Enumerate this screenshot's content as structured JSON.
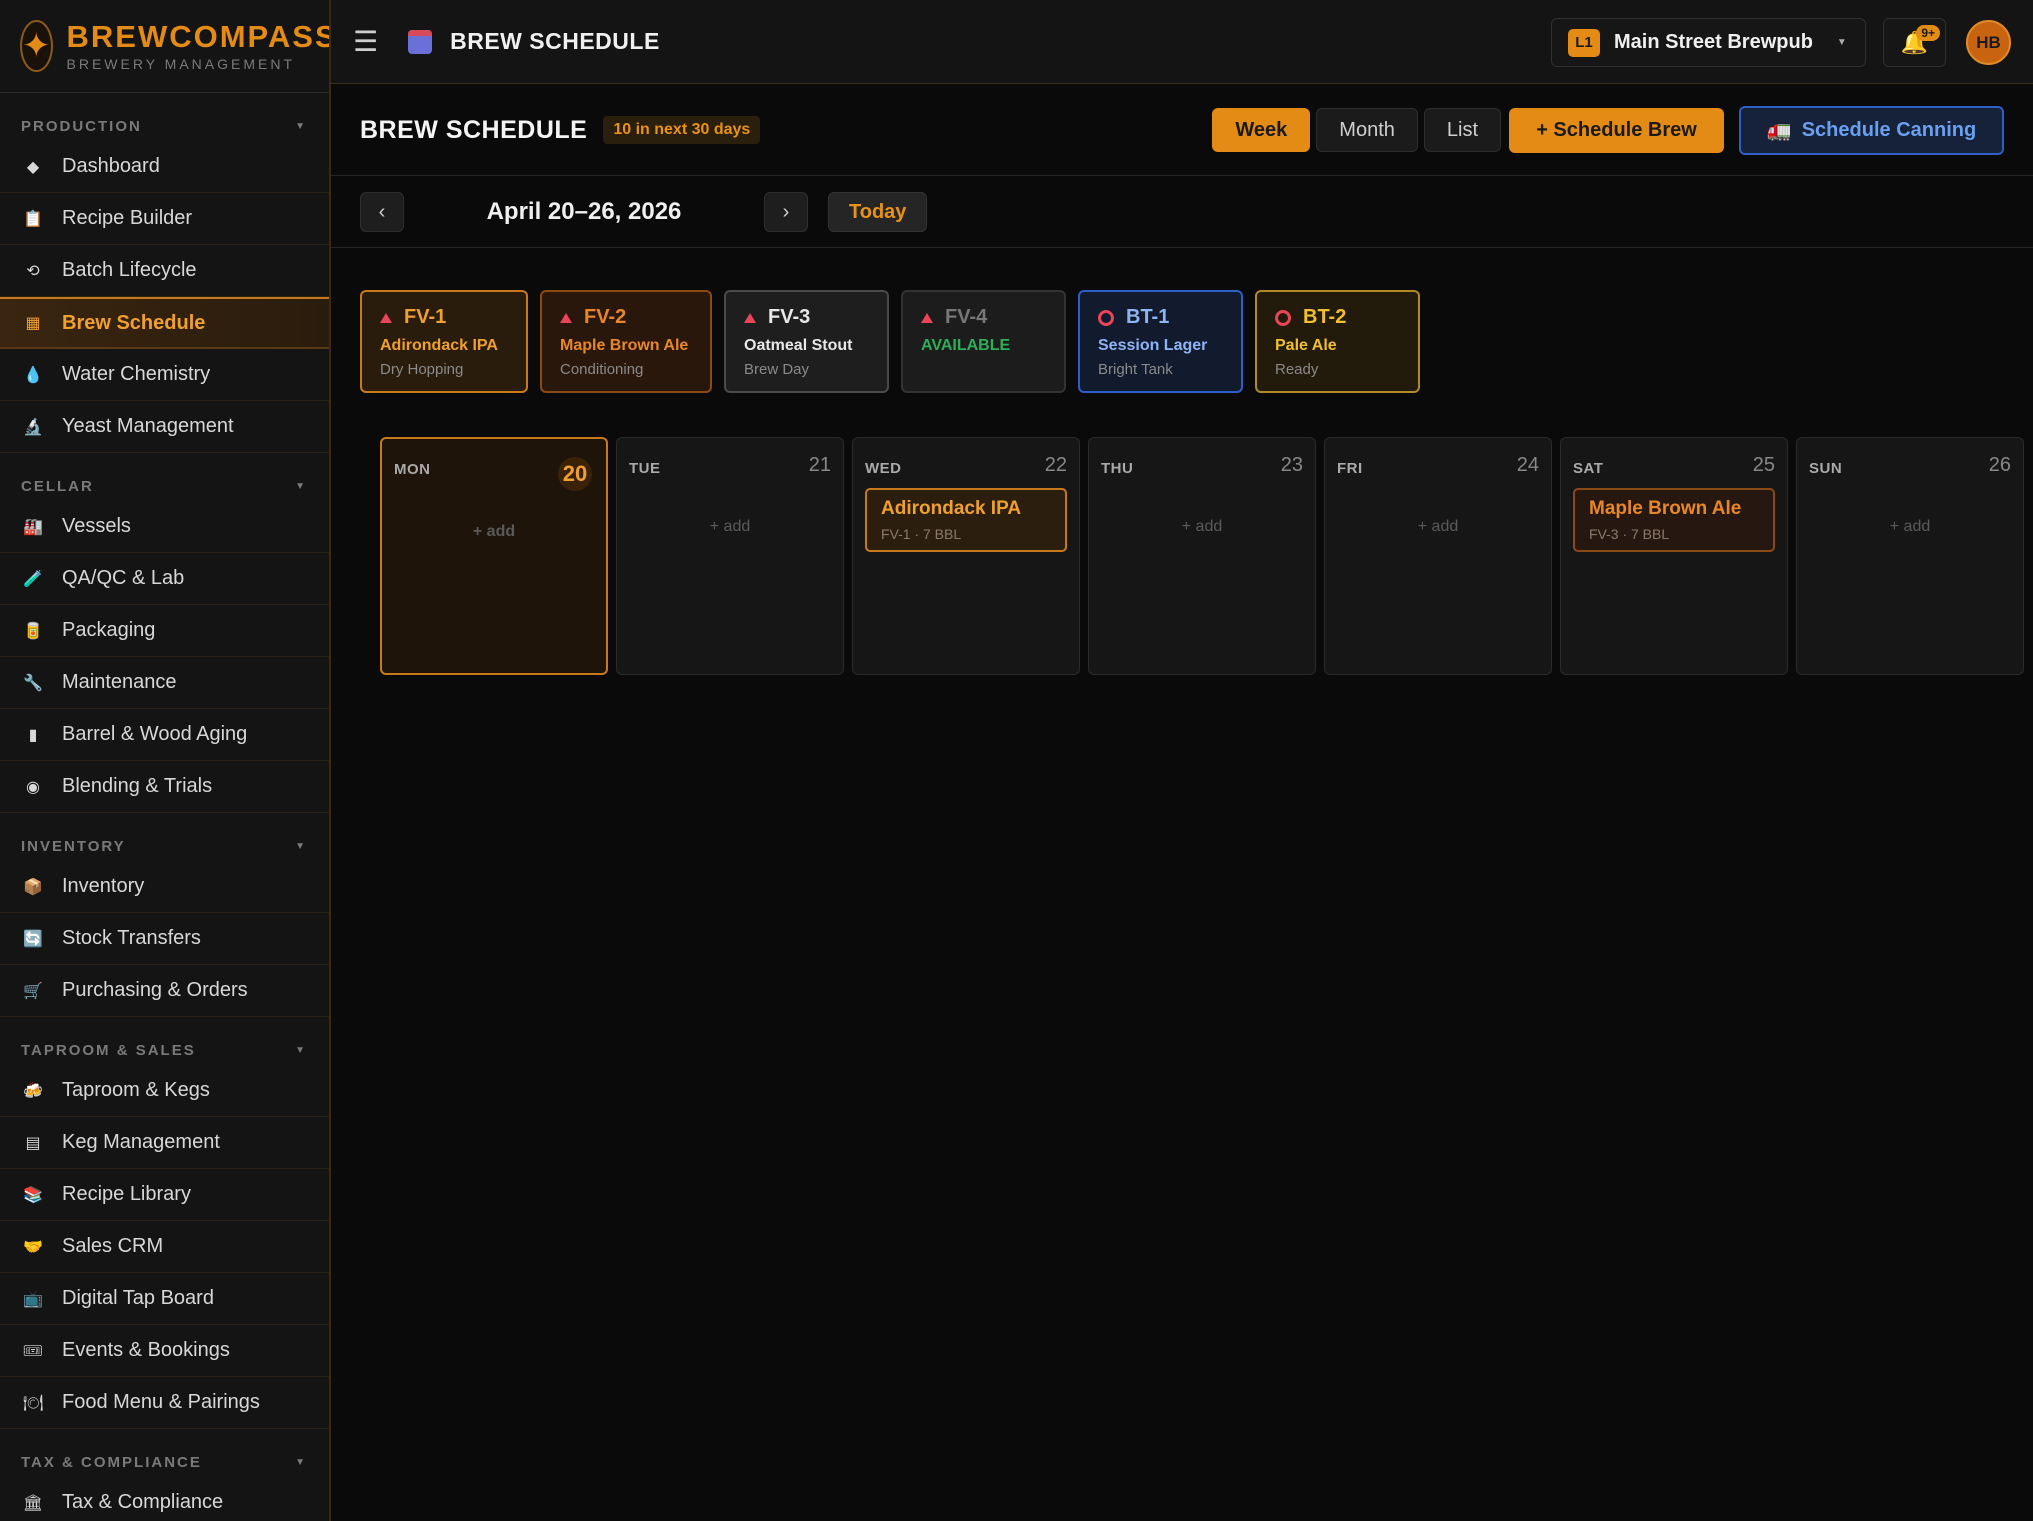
{
  "brand": {
    "name": "BREWCOMPASS",
    "subtitle": "BREWERY MANAGEMENT"
  },
  "sidebar": {
    "sections": [
      {
        "title": "PRODUCTION",
        "items": [
          "Dashboard",
          "Recipe Builder",
          "Batch Lifecycle",
          "Brew Schedule",
          "Water Chemistry",
          "Yeast Management"
        ]
      },
      {
        "title": "CELLAR",
        "items": [
          "Vessels",
          "QA/QC & Lab",
          "Packaging",
          "Maintenance",
          "Barrel & Wood Aging",
          "Blending & Trials"
        ]
      },
      {
        "title": "INVENTORY",
        "items": [
          "Inventory",
          "Stock Transfers",
          "Purchasing & Orders"
        ]
      },
      {
        "title": "TAPROOM & SALES",
        "items": [
          "Taproom & Kegs",
          "Keg Management",
          "Recipe Library",
          "Sales CRM",
          "Digital Tap Board",
          "Events & Bookings",
          "Food Menu & Pairings"
        ]
      },
      {
        "title": "TAX & COMPLIANCE",
        "items": [
          "Tax & Compliance"
        ]
      }
    ]
  },
  "header": {
    "title": "BREW SCHEDULE",
    "location_code": "L1",
    "location_name": "Main Street Brewpub",
    "notif_count": "9+",
    "avatar": "HB"
  },
  "page": {
    "title": "BREW SCHEDULE",
    "badge": "10 in next 30 days",
    "views": [
      "Week",
      "Month",
      "List"
    ],
    "active_view": "Week",
    "schedule_brew": "+ Schedule Brew",
    "schedule_canning": "Schedule Canning"
  },
  "weeknav": {
    "prev": "‹",
    "next": "›",
    "range": "April 20–26, 2026",
    "today": "Today"
  },
  "tanks": [
    {
      "id": "FV-1",
      "beer": "Adirondack IPA",
      "status": "Dry Hopping",
      "kind": "tri",
      "border": "#c87a1a",
      "bg": "#2a1c0c",
      "idcolor": "#f0a030",
      "beercolor": "#f0a030"
    },
    {
      "id": "FV-2",
      "beer": "Maple Brown Ale",
      "status": "Conditioning",
      "kind": "tri",
      "border": "#8a4a16",
      "bg": "#2a170c",
      "idcolor": "#e8872a",
      "beercolor": "#e8872a"
    },
    {
      "id": "FV-3",
      "beer": "Oatmeal Stout",
      "status": "Brew Day",
      "kind": "tri",
      "border": "#4a4a4a",
      "bg": "#1e1e1e",
      "idcolor": "#e8e8e8",
      "beercolor": "#e8e8e8"
    },
    {
      "id": "FV-4",
      "beer": "AVAILABLE",
      "status": "",
      "kind": "tri",
      "border": "#333",
      "bg": "#1c1c1c",
      "idcolor": "#777",
      "beercolor": "#2fae5a"
    },
    {
      "id": "BT-1",
      "beer": "Session Lager",
      "status": "Bright Tank",
      "kind": "ring",
      "border": "#2f5ec8",
      "bg": "#121a2e",
      "idcolor": "#8fb4f4",
      "beercolor": "#8fb4f4"
    },
    {
      "id": "BT-2",
      "beer": "Pale Ale",
      "status": "Ready",
      "kind": "ring",
      "border": "#b08a24",
      "bg": "#221a0a",
      "idcolor": "#f0c030",
      "beercolor": "#f0c030"
    }
  ],
  "days": [
    {
      "name": "MON",
      "num": "20",
      "today": true,
      "add": "+ add",
      "event": null
    },
    {
      "name": "TUE",
      "num": "21",
      "today": false,
      "add": "+ add",
      "event": null
    },
    {
      "name": "WED",
      "num": "22",
      "today": false,
      "add": "",
      "event": {
        "title": "Adirondack IPA",
        "detail": "FV-1 · 7 BBL",
        "alt": false
      }
    },
    {
      "name": "THU",
      "num": "23",
      "today": false,
      "add": "+ add",
      "event": null
    },
    {
      "name": "FRI",
      "num": "24",
      "today": false,
      "add": "+ add",
      "event": null
    },
    {
      "name": "SAT",
      "num": "25",
      "today": false,
      "add": "",
      "event": {
        "title": "Maple Brown Ale",
        "detail": "FV-3 · 7 BBL",
        "alt": true
      }
    },
    {
      "name": "SUN",
      "num": "26",
      "today": false,
      "add": "+ add",
      "event": null
    }
  ]
}
